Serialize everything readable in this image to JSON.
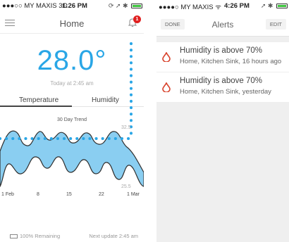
{
  "left": {
    "statusbar": {
      "carrier": "●●●○○ MY MAXIS  3G",
      "time": "1:26 PM",
      "icons": "⟳ ➚ ✱"
    },
    "header": {
      "title": "Home",
      "badge": "1"
    },
    "current": {
      "temperature": "28.0°",
      "updated": "Today at 2:45 am"
    },
    "tabs": [
      "Temperature",
      "Humidity"
    ],
    "selected_tab": "Temperature",
    "chart": {
      "title": "30 Day Trend",
      "max_label": "32.5",
      "min_label": "25.5",
      "x_ticks": [
        "1 Feb",
        "8",
        "15",
        "22",
        "1 Mar"
      ]
    },
    "footer": {
      "battery": "100% Remaining",
      "next_update": "Next update 2:45 am"
    }
  },
  "right": {
    "statusbar": {
      "carrier": "●●●●○ MY MAXIS  ᯤ",
      "time": "4:26 PM",
      "icons": "➚ ✱"
    },
    "header": {
      "title": "Alerts",
      "done": "DONE",
      "edit": "EDIT"
    },
    "alerts": [
      {
        "title": "Humidity is above 70%",
        "detail": "Home, Kitchen Sink, 16 hours ago"
      },
      {
        "title": "Humidity is above 70%",
        "detail": "Home, Kitchen Sink, yesterday"
      }
    ]
  },
  "colors": {
    "accent": "#29a6e6",
    "badge": "#e02020",
    "alert_icon": "#d8412a",
    "battery_fill": "#3ec43e"
  }
}
